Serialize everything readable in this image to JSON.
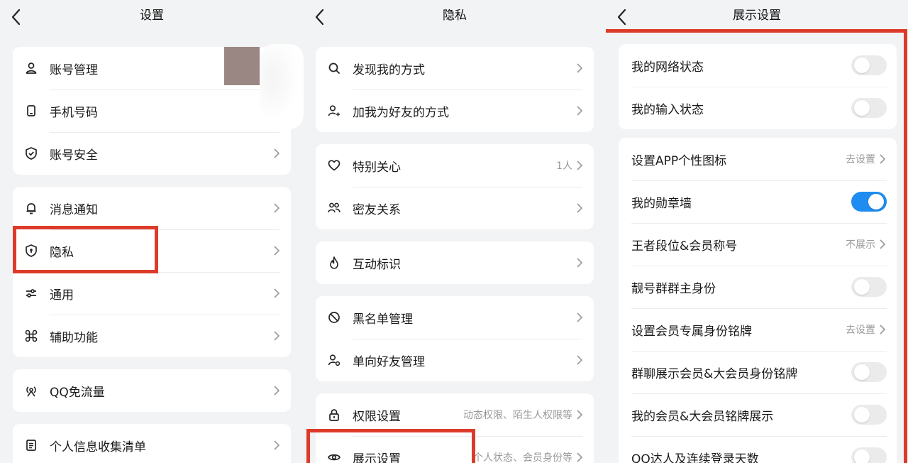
{
  "colors": {
    "accent": "#1e8cf0",
    "highlight": "#dd3b2a"
  },
  "panel1": {
    "title": "设置",
    "group1": [
      "账号管理",
      "手机号码",
      "账号安全"
    ],
    "group2": [
      "消息通知",
      "隐私",
      "通用",
      "辅助功能"
    ],
    "group3": [
      "QQ免流量"
    ],
    "group4": [
      "个人信息收集清单"
    ]
  },
  "panel2": {
    "title": "隐私",
    "group1": [
      "发现我的方式",
      "加我为好友的方式"
    ],
    "group2": [
      "特别关心",
      "密友关系"
    ],
    "special_care_value": "1人",
    "group3": [
      "互动标识"
    ],
    "group4": [
      "黑名单管理",
      "单向好友管理"
    ],
    "group5": [
      "权限设置",
      "展示设置"
    ],
    "permission_value": "动态权限、陌生人权限等",
    "display_value": "个人状态、会员身份等"
  },
  "panel3": {
    "title": "展示设置",
    "group1": [
      {
        "label": "我的网络状态",
        "toggle": false
      },
      {
        "label": "我的输入状态",
        "toggle": false
      }
    ],
    "group2": [
      {
        "label": "设置APP个性图标",
        "value": "去设置"
      },
      {
        "label": "我的勋章墙",
        "toggle": true
      },
      {
        "label": "王者段位&会员称号",
        "value": "不展示"
      },
      {
        "label": "靓号群群主身份",
        "toggle": false
      },
      {
        "label": "设置会员专属身份铭牌",
        "value": "去设置"
      },
      {
        "label": "群聊展示会员&大会员身份铭牌",
        "toggle": false
      },
      {
        "label": "我的会员&大会员铭牌展示",
        "toggle": false
      },
      {
        "label": "QQ达人及连续登录天数",
        "toggle": false
      }
    ]
  }
}
